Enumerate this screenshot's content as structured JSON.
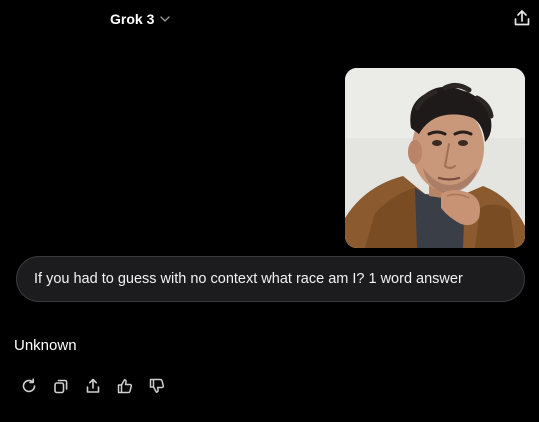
{
  "header": {
    "model_name": "Grok 3",
    "model_selector_icon": "chevron-down-icon",
    "share_icon": "share-icon"
  },
  "conversation": {
    "user_image": "selfie photo of a man with dark curly hair wearing a brown jacket",
    "user_message": "If you had to guess with no context what race am I? 1 word answer",
    "assistant_message": "Unknown"
  },
  "message_actions": [
    {
      "icon": "regenerate-icon"
    },
    {
      "icon": "copy-icon"
    },
    {
      "icon": "share-icon"
    },
    {
      "icon": "thumbs-up-icon"
    },
    {
      "icon": "thumbs-down-icon"
    }
  ],
  "colors": {
    "background": "#000000",
    "bubble": "#1c1c1e",
    "bubble_border": "#3a3a3e",
    "text": "#ffffff",
    "icon": "#cfcfcf"
  }
}
